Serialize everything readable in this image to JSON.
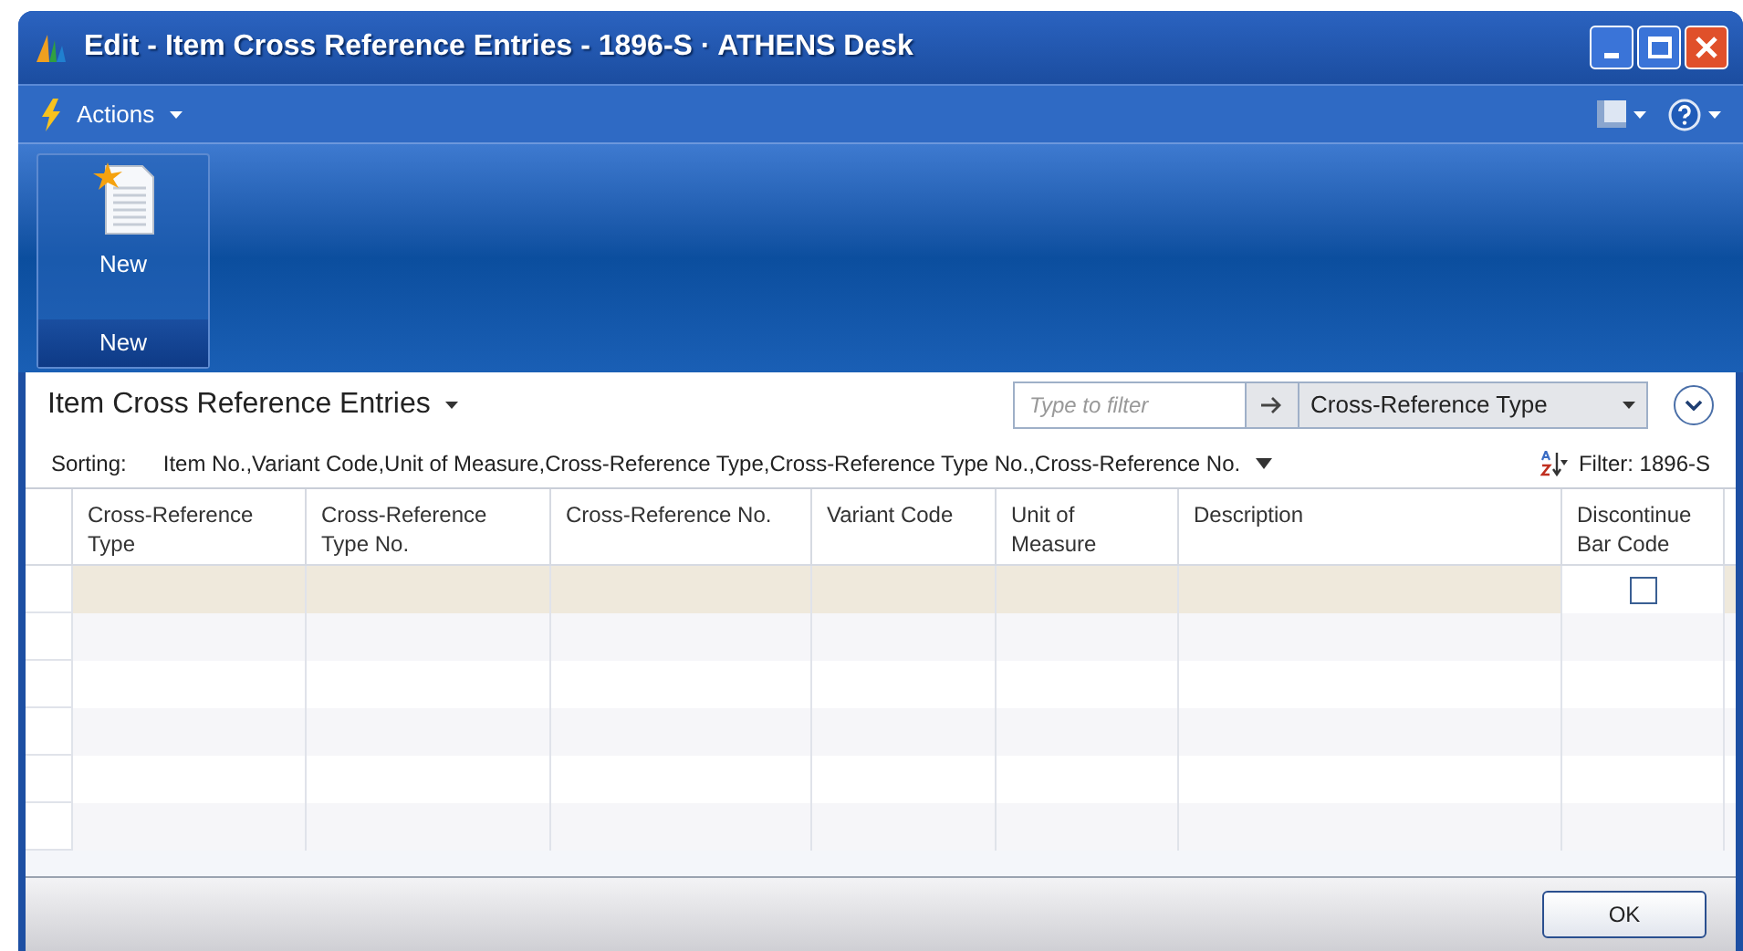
{
  "window": {
    "title": "Edit - Item Cross Reference Entries - 1896-S · ATHENS Desk"
  },
  "menu_bar": {
    "actions": "Actions"
  },
  "ribbon": {
    "buttons": [
      {
        "label": "New"
      }
    ],
    "group_label": "New"
  },
  "list": {
    "title": "Item Cross Reference Entries",
    "filter": {
      "placeholder": "Type to filter",
      "field": "Cross-Reference Type"
    },
    "sorting_label": "Sorting:",
    "sorting": "Item No.,Variant Code,Unit of Measure,Cross-Reference Type,Cross-Reference Type No.,Cross-Reference No.",
    "filter_text": "Filter: 1896-S"
  },
  "table": {
    "columns": [
      "Cross-Reference Type",
      "Cross-Reference Type No.",
      "Cross-Reference No.",
      "Variant Code",
      "Unit of Measure",
      "Description",
      "Discontinue Bar Code"
    ],
    "rows": [
      {
        "selected": true,
        "discontinue_bar_code": {
          "checked": false
        }
      },
      {
        "selected": false
      },
      {
        "selected": false
      },
      {
        "selected": false
      },
      {
        "selected": false
      },
      {
        "selected": false
      }
    ]
  },
  "buttons": [
    "OK"
  ]
}
